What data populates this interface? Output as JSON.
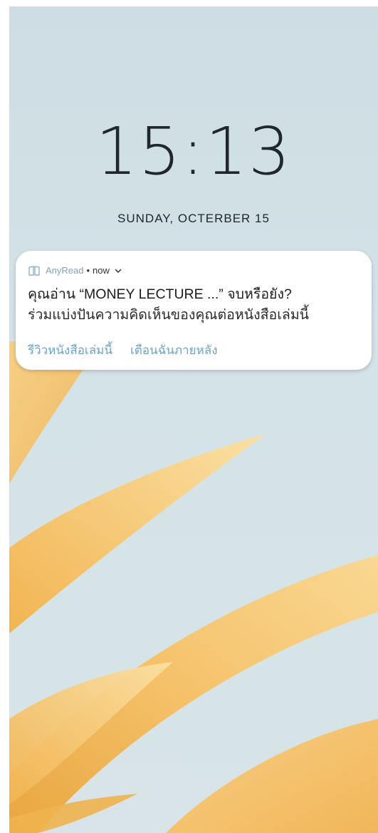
{
  "lockscreen": {
    "time": "15:13",
    "date": "SUNDAY, OCTERBER 15"
  },
  "notification": {
    "app_icon": "book-icon",
    "app_name": "AnyRead",
    "separator": "•",
    "timestamp": "now",
    "expand_icon": "chevron-down-icon",
    "title": "คุณอ่าน “MONEY LECTURE ...” จบหรือยัง?",
    "body": "ร่วมแบ่งปันความคิดเห็นของคุณต่อหนังสือเล่มนี้",
    "actions": [
      {
        "label": "รีวิวหนังสือเล่มนี้"
      },
      {
        "label": "เตือนฉันภายหลัง"
      }
    ]
  },
  "colors": {
    "wallpaper_bg": "#cddde3",
    "petal_light": "#f7d28a",
    "petal_dark": "#eeb04e",
    "app_accent": "#7ba6c3",
    "action_text": "#6fa3c9",
    "clock_text": "#20262a"
  }
}
